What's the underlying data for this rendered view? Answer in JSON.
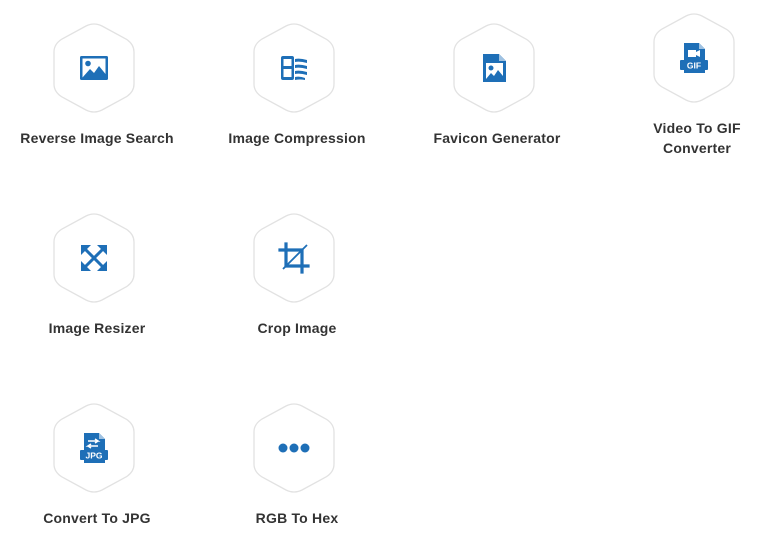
{
  "colors": {
    "accent": "#1e6fb7",
    "label": "#333333",
    "hex_border": "#e2e2e2"
  },
  "tools": [
    {
      "label": "Reverse Image Search",
      "icon": "image-icon"
    },
    {
      "label": "Image Compression",
      "icon": "compress-icon"
    },
    {
      "label": "Favicon Generator",
      "icon": "image-file-icon"
    },
    {
      "label_line1": "Video To GIF",
      "label_line2": "Converter",
      "icon": "gif-file-icon"
    },
    {
      "label": "Image Resizer",
      "icon": "expand-arrows-icon"
    },
    {
      "label": "Crop Image",
      "icon": "crop-icon"
    },
    {
      "label": "Convert To JPG",
      "icon": "jpg-file-icon"
    },
    {
      "label": "RGB To Hex",
      "icon": "ellipsis-icon"
    }
  ]
}
